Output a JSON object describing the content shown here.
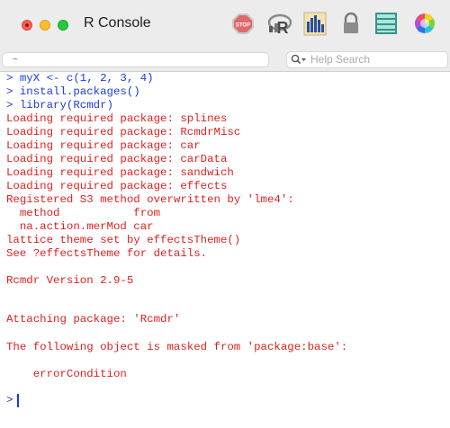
{
  "window": {
    "title": "R Console"
  },
  "toolbar": {
    "icons": [
      "stop-icon",
      "r-logo-icon",
      "chart-icon",
      "lock-icon",
      "list-icon",
      "color-wheel-icon"
    ],
    "stop_label": "STOP"
  },
  "dir_bar": {
    "value": "~"
  },
  "help_search": {
    "placeholder": "Help Search"
  },
  "colors": {
    "output": "#e02020",
    "input": "#1a3cd8",
    "chrome": "#ececec"
  },
  "console": {
    "lines": [
      "> myX <- c(1, 2, 3, 4)",
      "> install.packages()",
      "> library(Rcmdr)",
      "Loading required package: splines",
      "Loading required package: RcmdrMisc",
      "Loading required package: car",
      "Loading required package: carData",
      "Loading required package: sandwich",
      "Loading required package: effects",
      "Registered S3 method overwritten by 'lme4':",
      "  method           from",
      "  na.action.merMod car",
      "lattice theme set by effectsTheme()",
      "See ?effectsTheme for details.",
      "Rcmdr Version 2.9-5",
      "Attaching package: 'Rcmdr'",
      "The following object is masked from 'package:base':",
      "    errorCondition",
      ">"
    ]
  }
}
